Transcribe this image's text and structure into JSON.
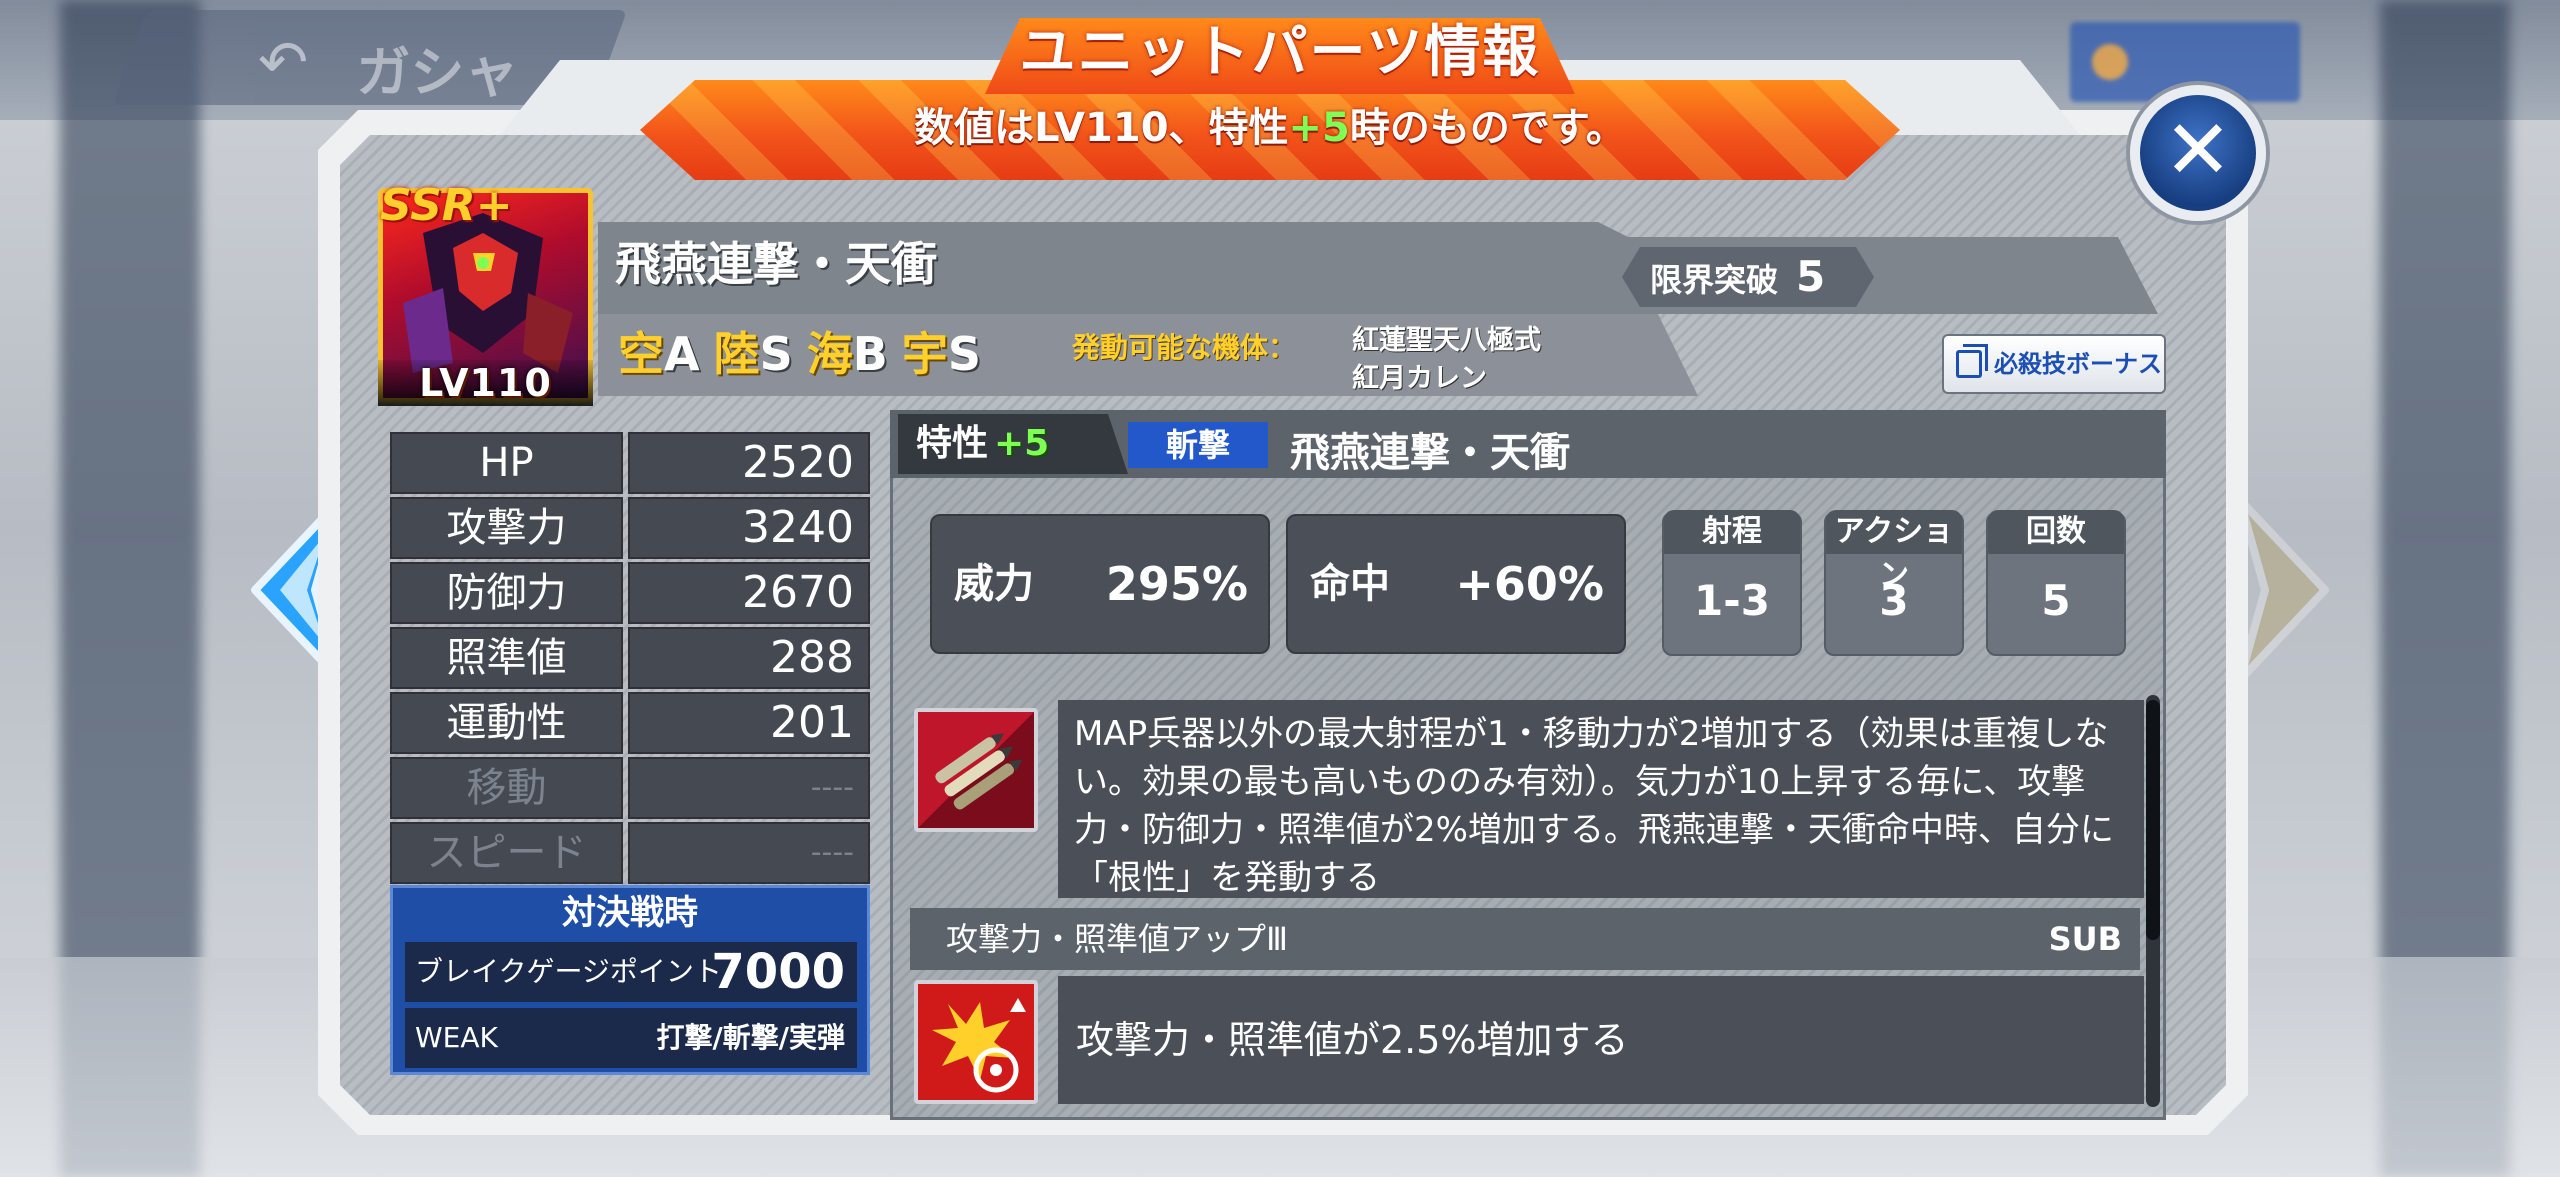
{
  "background": {
    "back_label": "ガシャ"
  },
  "header": {
    "title": "ユニットパーツ情報",
    "subtitle_pre": "数値はLV110、特性",
    "subtitle_highlight": "+5",
    "subtitle_post": "時のものです。",
    "close_label": "✕"
  },
  "unit": {
    "rarity": "SSR+",
    "level": "LV110",
    "name": "飛燕連撃・天衝",
    "limit_break_label": "限界突破",
    "limit_break_value": "5",
    "terrain": [
      {
        "k": "空",
        "v": "A"
      },
      {
        "k": "陸",
        "v": "S"
      },
      {
        "k": "海",
        "v": "B"
      },
      {
        "k": "宇",
        "v": "S"
      }
    ],
    "activatable_label": "発動可能な機体：",
    "activatable_units": [
      "紅蓮聖天八極式",
      "紅月カレン"
    ],
    "bonus_button": "必殺技ボーナス"
  },
  "stats": [
    {
      "k": "HP",
      "v": "2520"
    },
    {
      "k": "攻撃力",
      "v": "3240"
    },
    {
      "k": "防御力",
      "v": "2670"
    },
    {
      "k": "照準値",
      "v": "288"
    },
    {
      "k": "運動性",
      "v": "201"
    },
    {
      "k": "移動",
      "v": "----"
    },
    {
      "k": "スピード",
      "v": "----"
    }
  ],
  "battle": {
    "title": "対決戦時",
    "break_label": "ブレイクゲージポイント",
    "break_value": "7000",
    "weak_label": "WEAK",
    "weak_value": "打撃/斬撃/実弾"
  },
  "trait": {
    "label": "特性",
    "level": "+5",
    "type": "斬撃",
    "skill_name": "飛燕連撃・天衝",
    "power_label": "威力",
    "power_value": "295%",
    "accuracy_label": "命中",
    "accuracy_value": "+60%",
    "range_label": "射程",
    "range_value": "1-3",
    "action_label": "アクション",
    "action_value": "3",
    "count_label": "回数",
    "count_value": "5",
    "main_desc": "MAP兵器以外の最大射程が1・移動力が2増加する（効果は重複しない。効果の最も高いもののみ有効）。気力が10上昇する毎に、攻撃力・防御力・照準値が2%増加する。飛燕連撃・天衝命中時、自分に「根性」を発動する",
    "sub_name": "攻撃力・照準値アップⅢ",
    "sub_tag": "SUB",
    "sub_desc": "攻撃力・照準値が2.5%増加する"
  },
  "icons": {
    "left_nav": "left-arrow-icon",
    "right_nav": "right-arrow-icon",
    "close": "close-icon",
    "bonus": "copy-icon",
    "skill_main": "missile-pod-icon",
    "skill_sub": "target-explosion-icon"
  },
  "colors": {
    "banner": "#f2541a",
    "highlight_green": "#7dff53",
    "gold": "#ffd02b",
    "blue_panel": "#1f4ea6",
    "type_tag": "#2258c9"
  }
}
